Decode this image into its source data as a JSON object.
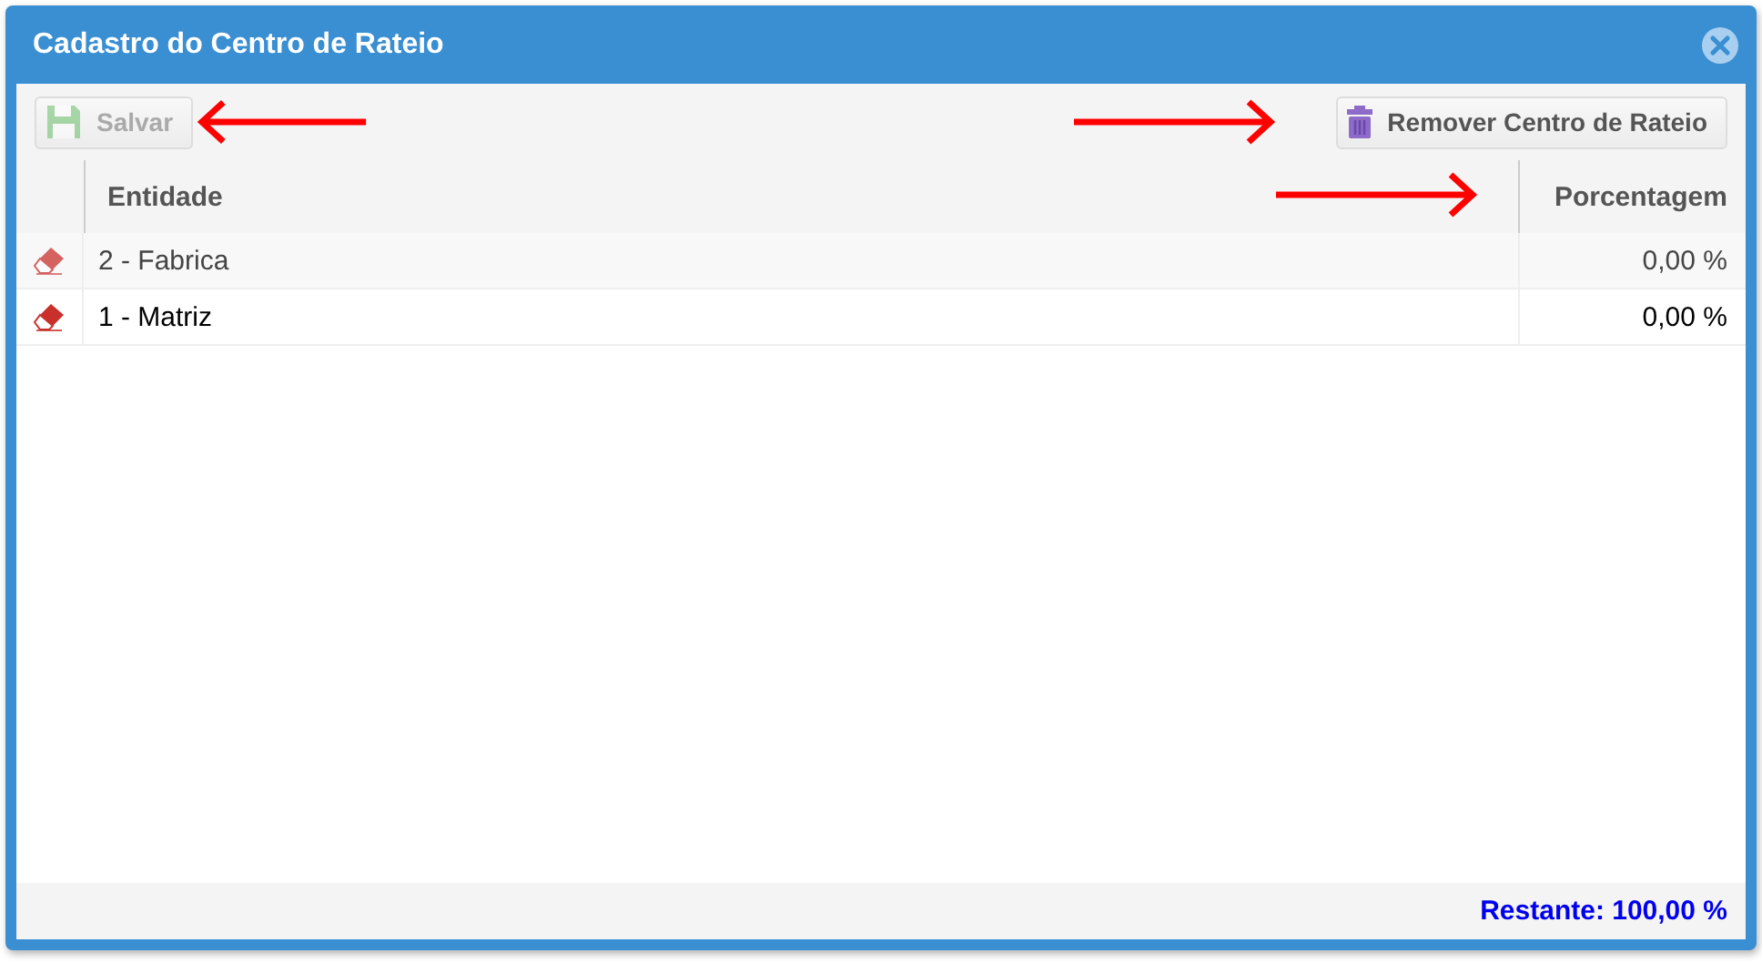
{
  "window": {
    "title": "Cadastro do Centro de Rateio"
  },
  "toolbar": {
    "save_button": {
      "label": "Salvar",
      "disabled": true
    },
    "remove_button": {
      "label": "Remover Centro de Rateio",
      "disabled": false
    }
  },
  "table": {
    "columns": [
      "Entidade",
      "Porcentagem"
    ],
    "rows": [
      {
        "entity": "2 - Fabrica",
        "percentage": "0,00 %"
      },
      {
        "entity": "1 - Matriz",
        "percentage": "0,00 %"
      }
    ]
  },
  "status_bar": {
    "remaining": "Restante: 100,00 %"
  }
}
